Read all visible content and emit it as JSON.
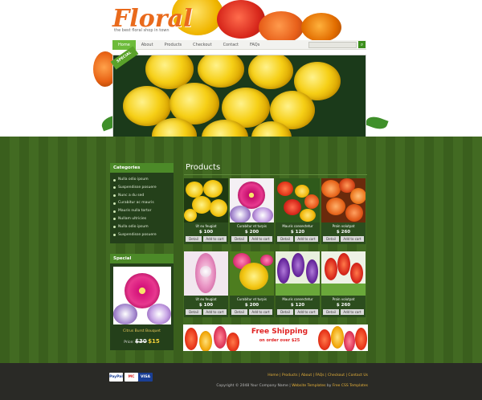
{
  "logo": {
    "title": "Floral",
    "tagline": "the best floral shop in town"
  },
  "nav": {
    "items": [
      "Home",
      "About",
      "Products",
      "Checkout",
      "Contact",
      "FAQs"
    ],
    "active_index": 0
  },
  "search": {
    "button_icon": "search-icon"
  },
  "banner": {
    "tag": "SPECIAL"
  },
  "categories": {
    "title": "Categories",
    "items": [
      "Nulla odio ipsum",
      "Suspendisse posuere",
      "Nunc a du sed",
      "Curabitur ac mauris",
      "Mauris nulla tortor",
      "Nullam ultricies",
      "Nulla odio ipsum",
      "Suspendisse posuere"
    ]
  },
  "special": {
    "title": "Special",
    "name": "Citrus Burst Bouquet",
    "price_label": "Price",
    "old_price": "$30",
    "new_price": "$15"
  },
  "products": {
    "title": "Products",
    "detail_label": "Detail",
    "cart_label": "Add to cart",
    "items": [
      {
        "name": "Ut eu feugiat",
        "price": "$ 100"
      },
      {
        "name": "Curabitur et turpis",
        "price": "$ 200"
      },
      {
        "name": "Mauris consectetur",
        "price": "$ 120"
      },
      {
        "name": "Proin volutpat",
        "price": "$ 260"
      },
      {
        "name": "Ut eu feugiat",
        "price": "$ 100"
      },
      {
        "name": "Curabitur et turpis",
        "price": "$ 200"
      },
      {
        "name": "Mauris consectetur",
        "price": "$ 120"
      },
      {
        "name": "Proin volutpat",
        "price": "$ 260"
      }
    ]
  },
  "shipping_banner": {
    "line1": "Free Shipping",
    "line2": "on order over $25"
  },
  "footer": {
    "cards": [
      "PayPal",
      "MC",
      "VISA"
    ],
    "links": [
      "Home",
      "Products",
      "About",
      "FAQs",
      "Checkout",
      "Contact Us"
    ],
    "copyright": "Copyright © 2048 Your Company Name",
    "templates_link": "Website Templates",
    "by_text": "by",
    "css_link": "Free CSS Templates"
  },
  "colors": {
    "accent": "#6dbb3a",
    "orange": "#e96a1c",
    "green_bg": "#3a5f1d",
    "footer_bg": "#2a2a26"
  }
}
